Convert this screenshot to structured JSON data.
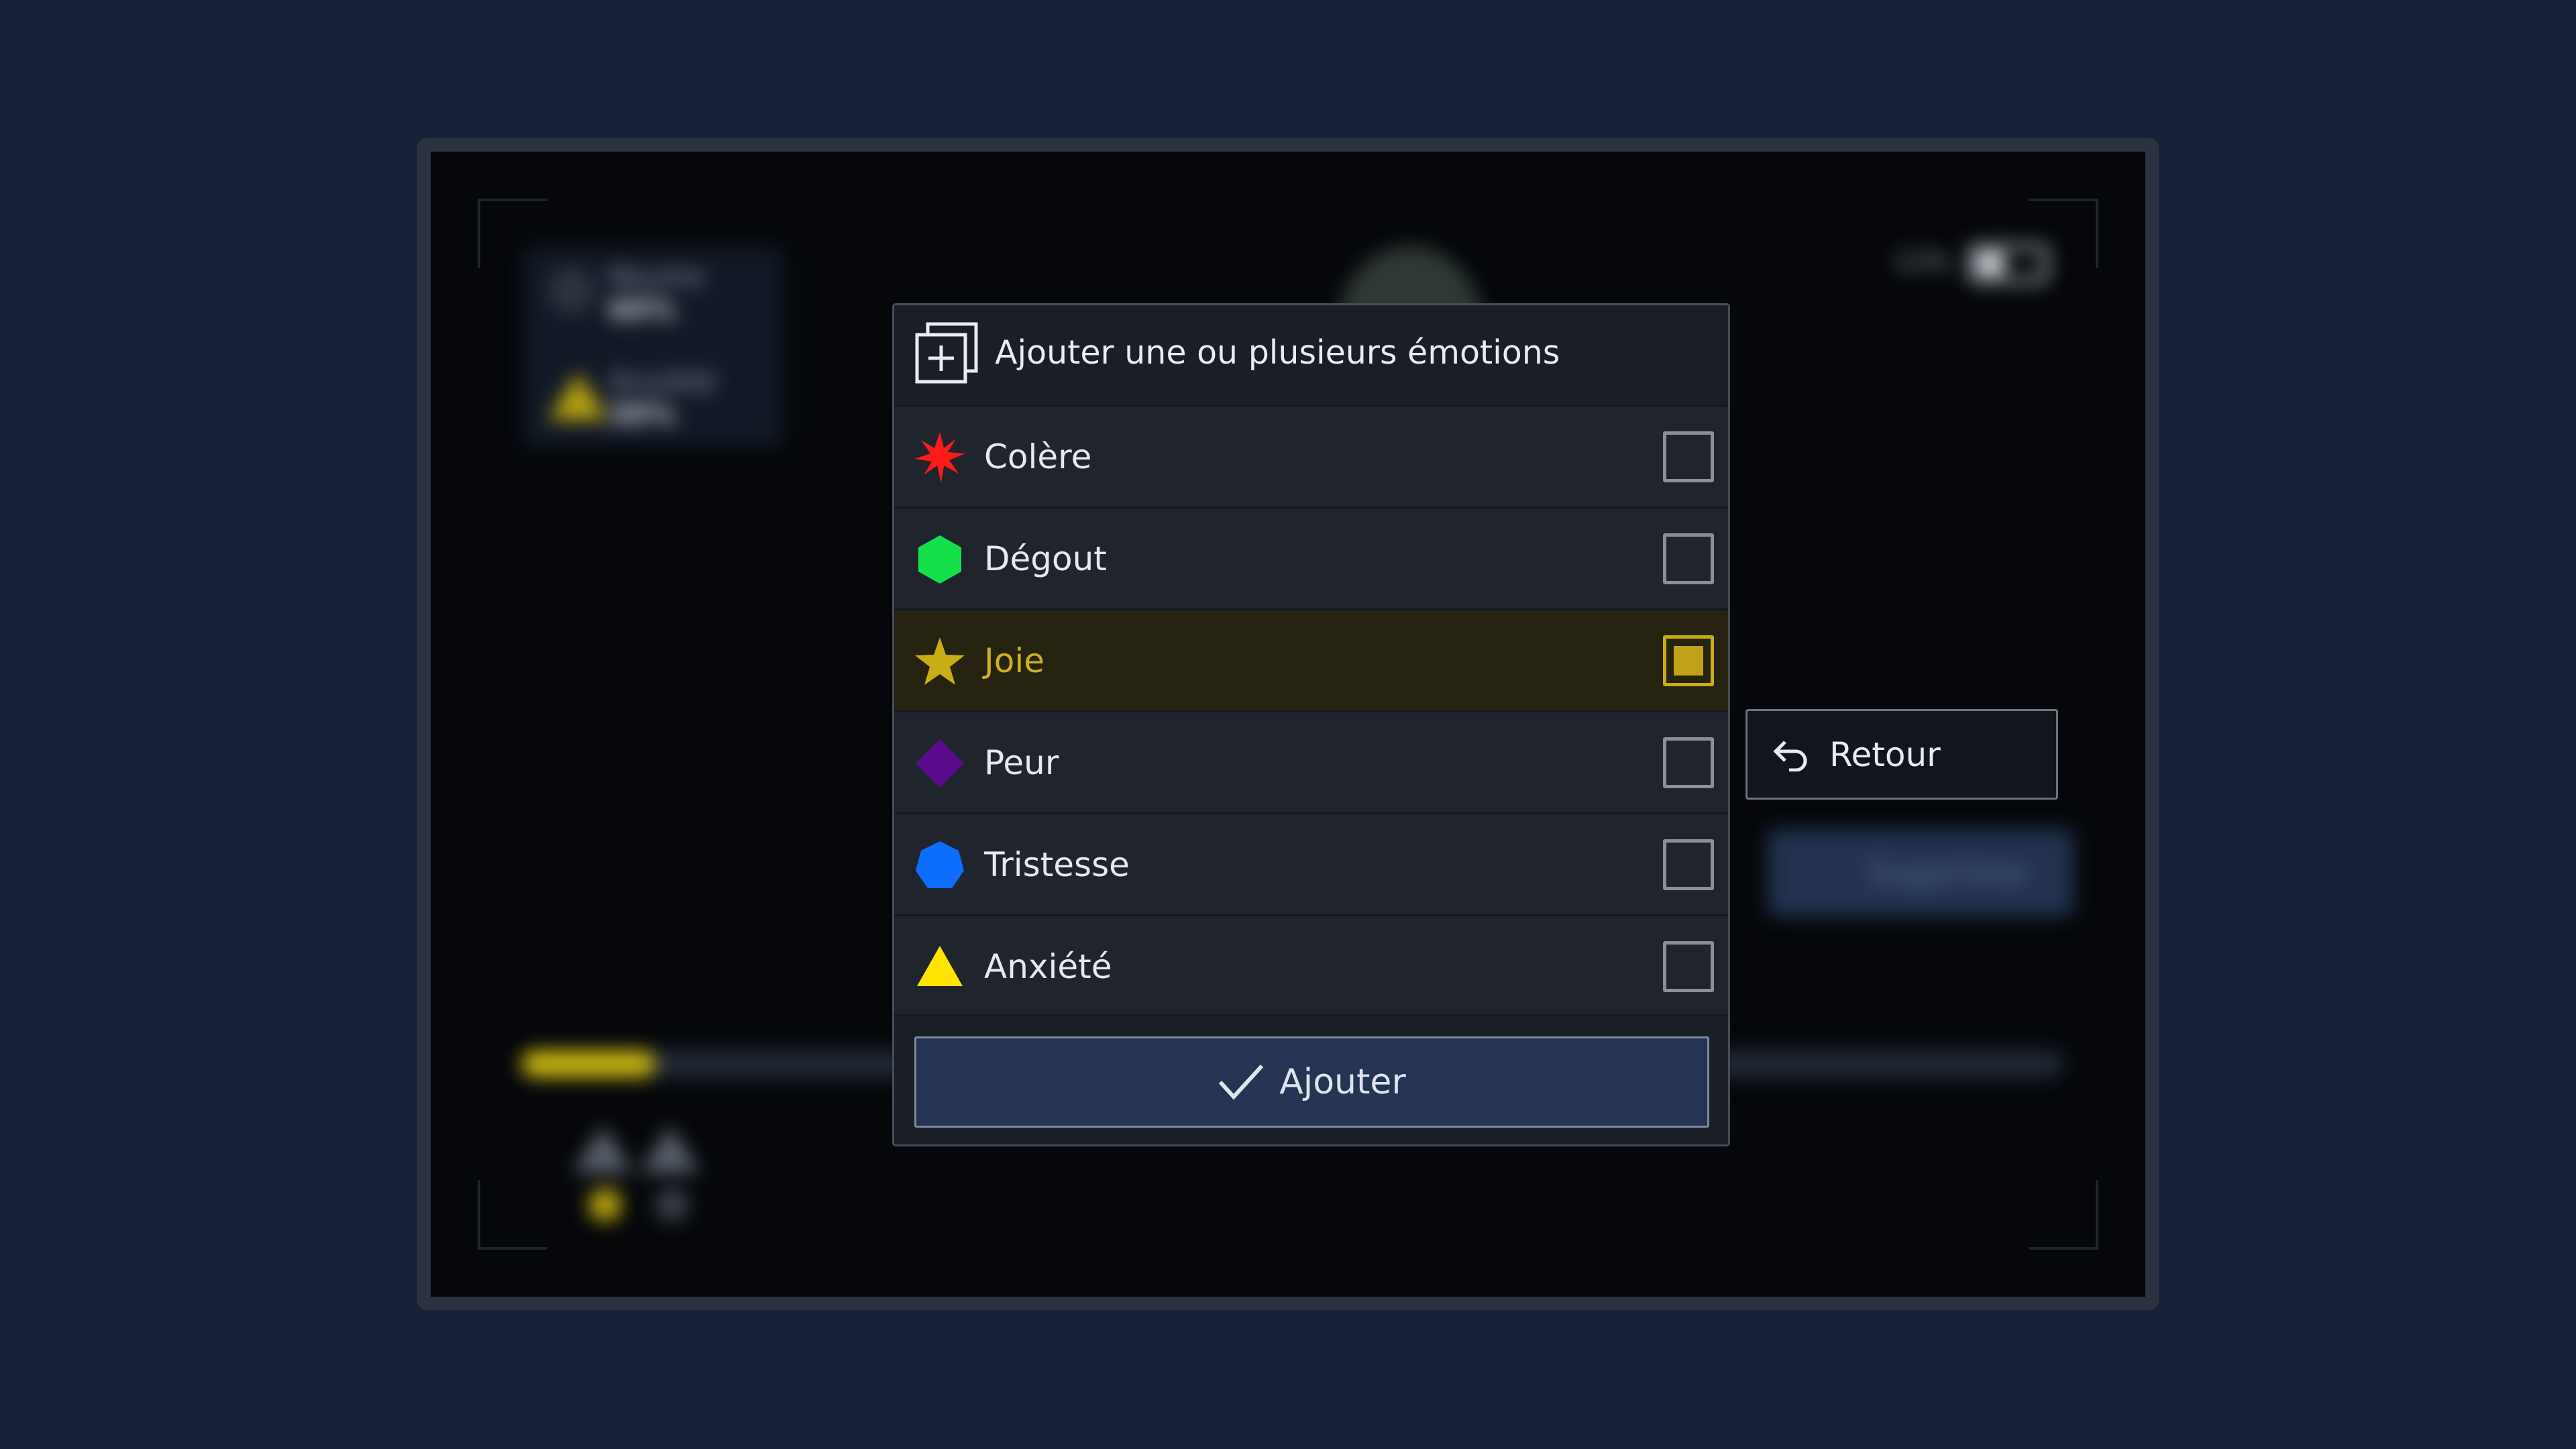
{
  "background": {
    "panel_items": [
      {
        "name": "Neutre",
        "value": "60%"
      },
      {
        "name": "Anxiété",
        "value": "30%"
      }
    ],
    "battery_text": "12%",
    "delete_label": "Supprimer"
  },
  "dialog": {
    "title": "Ajouter une ou plusieurs émotions",
    "header_icon": "add-stack-icon",
    "emotions": [
      {
        "label": "Colère",
        "icon": "red-starburst-icon",
        "color": "#ff1a1a",
        "checked": false
      },
      {
        "label": "Dégout",
        "icon": "green-hexagon-icon",
        "color": "#14e04a",
        "checked": false
      },
      {
        "label": "Joie",
        "icon": "gold-star-icon",
        "color": "#c9ad16",
        "checked": true
      },
      {
        "label": "Peur",
        "icon": "purple-diamond-icon",
        "color": "#5a0c8c",
        "checked": false
      },
      {
        "label": "Tristesse",
        "icon": "blue-heptagon-icon",
        "color": "#0d6efd",
        "checked": false
      },
      {
        "label": "Anxiété",
        "icon": "yellow-triangle-icon",
        "color": "#ffe400",
        "checked": false
      }
    ],
    "add_button": "Ajouter"
  },
  "side": {
    "back_button": "Retour"
  },
  "colors": {
    "page_background": "#172239",
    "dialog_background": "#1a1e26",
    "selected_row": "#262311",
    "accent_gold": "#c9ad16",
    "add_button": "#243452"
  }
}
